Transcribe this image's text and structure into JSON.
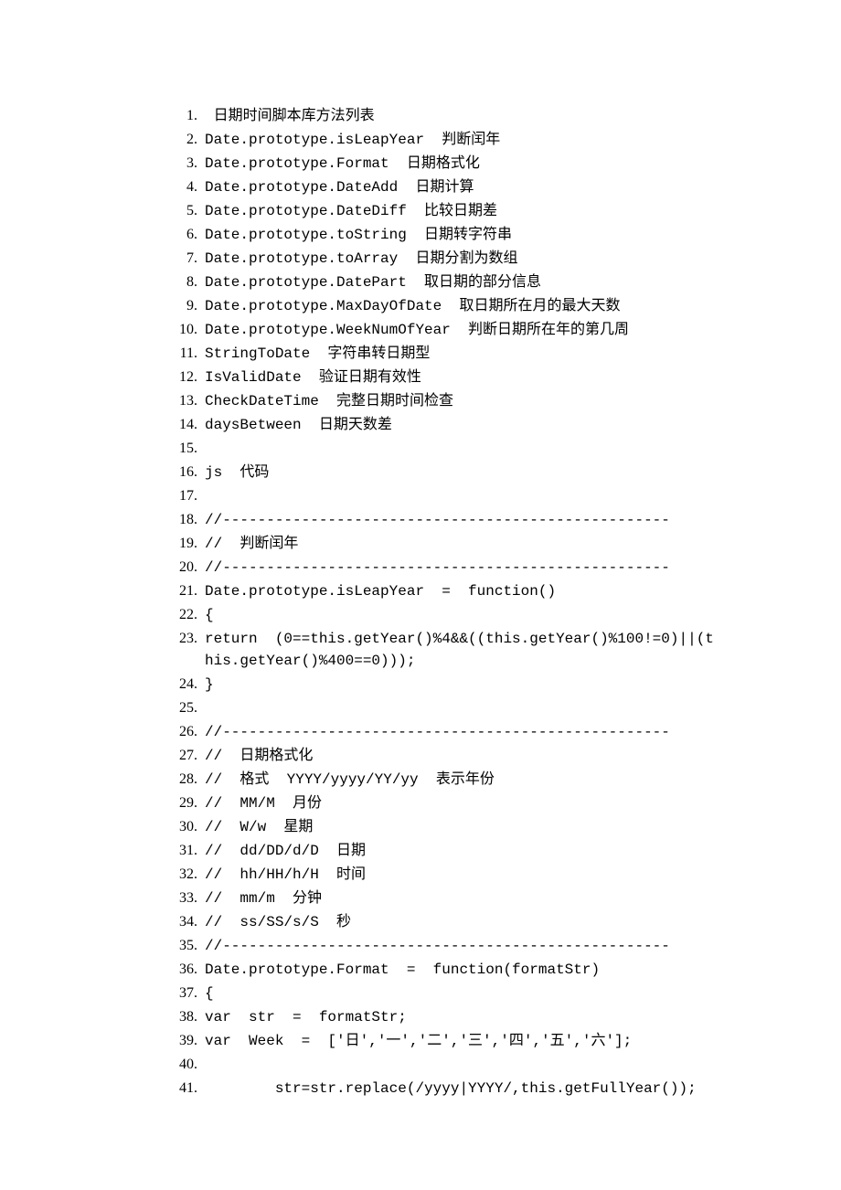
{
  "lines": [
    {
      "n": "1",
      "t": " 日期时间脚本库方法列表"
    },
    {
      "n": "2",
      "t": "Date.prototype.isLeapYear  判断闰年"
    },
    {
      "n": "3",
      "t": "Date.prototype.Format  日期格式化"
    },
    {
      "n": "4",
      "t": "Date.prototype.DateAdd  日期计算"
    },
    {
      "n": "5",
      "t": "Date.prototype.DateDiff  比较日期差"
    },
    {
      "n": "6",
      "t": "Date.prototype.toString  日期转字符串"
    },
    {
      "n": "7",
      "t": "Date.prototype.toArray  日期分割为数组"
    },
    {
      "n": "8",
      "t": "Date.prototype.DatePart  取日期的部分信息"
    },
    {
      "n": "9",
      "t": "Date.prototype.MaxDayOfDate  取日期所在月的最大天数"
    },
    {
      "n": "10",
      "t": "Date.prototype.WeekNumOfYear  判断日期所在年的第几周"
    },
    {
      "n": "11",
      "t": "StringToDate  字符串转日期型"
    },
    {
      "n": "12",
      "t": "IsValidDate  验证日期有效性"
    },
    {
      "n": "13",
      "t": "CheckDateTime  完整日期时间检查"
    },
    {
      "n": "14",
      "t": "daysBetween  日期天数差"
    },
    {
      "n": "15",
      "t": ""
    },
    {
      "n": "16",
      "t": "js  代码"
    },
    {
      "n": "17",
      "t": ""
    },
    {
      "n": "18",
      "t": "//---------------------------------------------------"
    },
    {
      "n": "19",
      "t": "//  判断闰年"
    },
    {
      "n": "20",
      "t": "//---------------------------------------------------"
    },
    {
      "n": "21",
      "t": "Date.prototype.isLeapYear  =  function()"
    },
    {
      "n": "22",
      "t": "{"
    },
    {
      "n": "23",
      "t": "return  (0==this.getYear()%4&&((this.getYear()%100!=0)||(this.getYear()%400==0)));"
    },
    {
      "n": "24",
      "t": "}"
    },
    {
      "n": "25",
      "t": ""
    },
    {
      "n": "26",
      "t": "//---------------------------------------------------"
    },
    {
      "n": "27",
      "t": "//  日期格式化"
    },
    {
      "n": "28",
      "t": "//  格式  YYYY/yyyy/YY/yy  表示年份"
    },
    {
      "n": "29",
      "t": "//  MM/M  月份"
    },
    {
      "n": "30",
      "t": "//  W/w  星期"
    },
    {
      "n": "31",
      "t": "//  dd/DD/d/D  日期"
    },
    {
      "n": "32",
      "t": "//  hh/HH/h/H  时间"
    },
    {
      "n": "33",
      "t": "//  mm/m  分钟"
    },
    {
      "n": "34",
      "t": "//  ss/SS/s/S  秒"
    },
    {
      "n": "35",
      "t": "//---------------------------------------------------"
    },
    {
      "n": "36",
      "t": "Date.prototype.Format  =  function(formatStr)"
    },
    {
      "n": "37",
      "t": "{"
    },
    {
      "n": "38",
      "t": "var  str  =  formatStr;"
    },
    {
      "n": "39",
      "t": "var  Week  =  ['日','一','二','三','四','五','六'];"
    },
    {
      "n": "40",
      "t": ""
    },
    {
      "n": "41",
      "t": "        str=str.replace(/yyyy|YYYY/,this.getFullYear());"
    }
  ]
}
